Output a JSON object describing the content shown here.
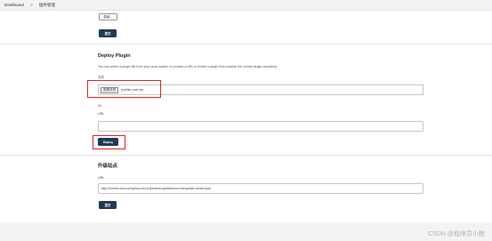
{
  "breadcrumb": {
    "home": "Dashboard",
    "separator": ">",
    "current": "插件管理"
  },
  "top": {
    "browse_label": "高级...",
    "submit_label": "提交"
  },
  "deploy": {
    "title": "Deploy Plugin",
    "description": "You can select a plugin file from your local system or provide a URL to install a plugin from outside the central plugin repository.",
    "file_label": "文件",
    "file_button": "选择文件",
    "file_name": "publish-over.hpi",
    "or_label": "Or",
    "url_label": "URL",
    "url_value": "",
    "deploy_label": "Deploy"
  },
  "update_site": {
    "title": "升级站点",
    "url_label": "URL",
    "url_value": "http://mirrors.tuna.tsinghua.edu.cn/jenkins/updates/current/update-center.json",
    "submit_label": "提交"
  },
  "watermark": "CSDN @程序员小鲸",
  "colors": {
    "primary_button": "#1f3a55",
    "highlight": "#e0222d"
  }
}
